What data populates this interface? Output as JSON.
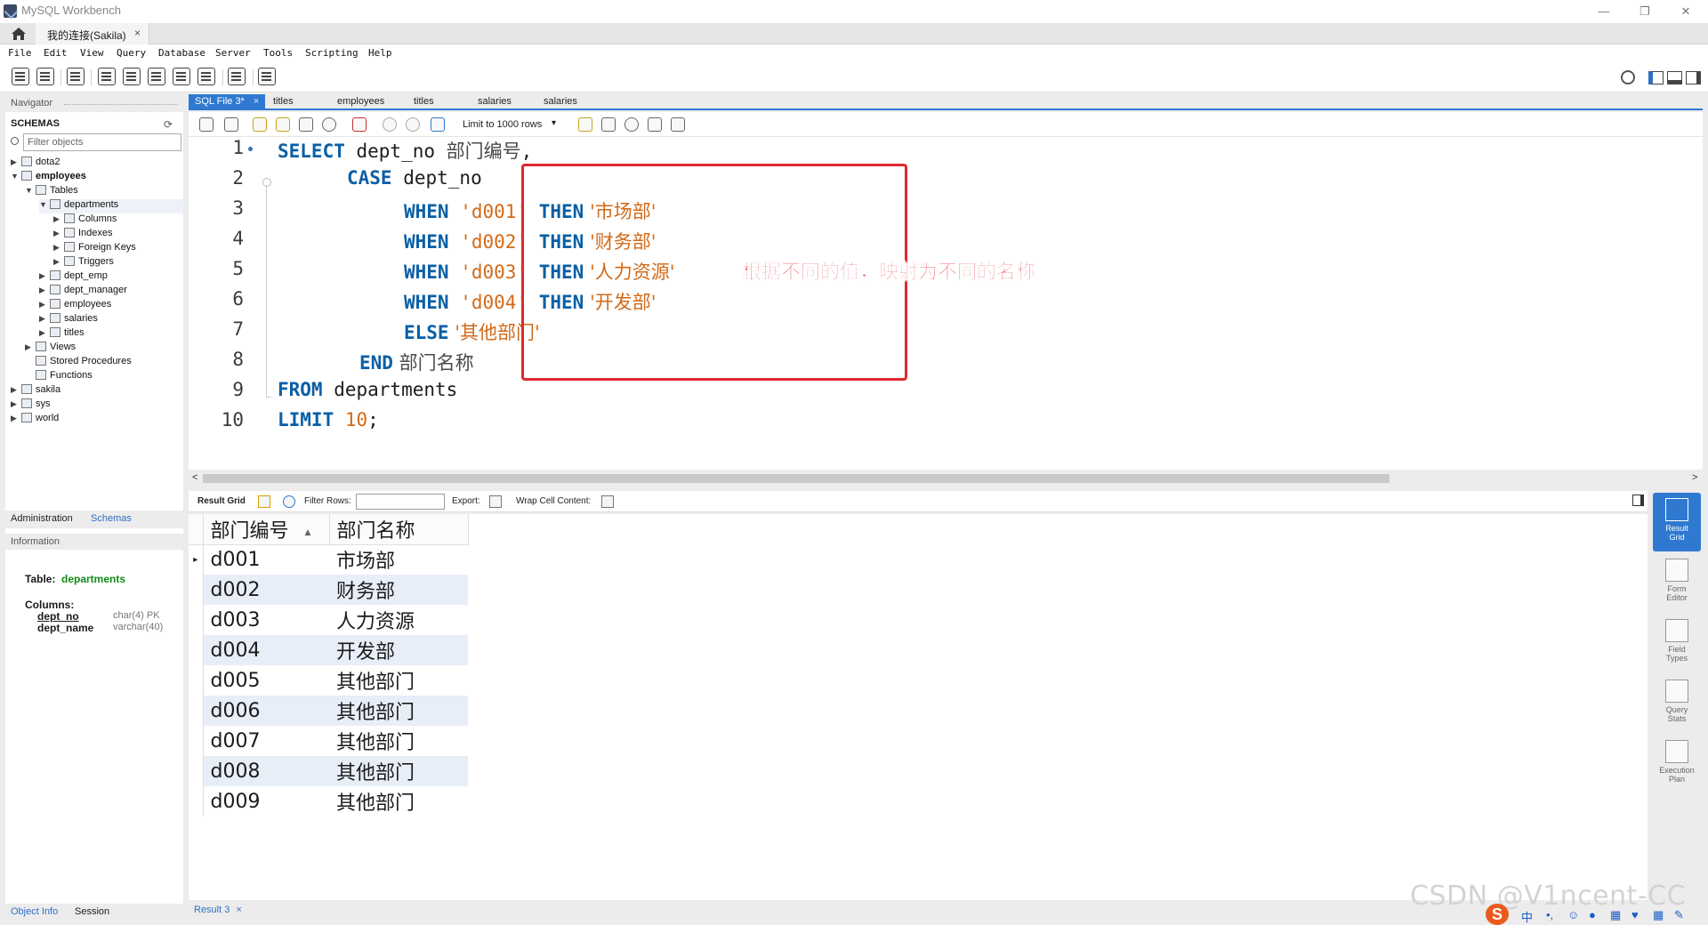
{
  "window": {
    "title": "MySQL Workbench",
    "min": "—",
    "max": "❐",
    "close": "✕"
  },
  "connection_tab": {
    "label": "我的连接(Sakila)",
    "close": "×"
  },
  "menu": [
    "File",
    "Edit",
    "View",
    "Query",
    "Database",
    "Server",
    "Tools",
    "Scripting",
    "Help"
  ],
  "navigator": {
    "header": "Navigator",
    "schemas_label": "SCHEMAS",
    "filter_placeholder": "Filter objects",
    "tree": [
      {
        "label": "dota2",
        "level": 0,
        "toggle": "▶"
      },
      {
        "label": "employees",
        "level": 0,
        "toggle": "▼",
        "bold": true
      },
      {
        "label": "Tables",
        "level": 1,
        "toggle": "▼"
      },
      {
        "label": "departments",
        "level": 2,
        "toggle": "▼",
        "selected": true
      },
      {
        "label": "Columns",
        "level": 3,
        "toggle": "▶"
      },
      {
        "label": "Indexes",
        "level": 3,
        "toggle": "▶"
      },
      {
        "label": "Foreign Keys",
        "level": 3,
        "toggle": "▶"
      },
      {
        "label": "Triggers",
        "level": 3,
        "toggle": "▶"
      },
      {
        "label": "dept_emp",
        "level": 2,
        "toggle": "▶"
      },
      {
        "label": "dept_manager",
        "level": 2,
        "toggle": "▶"
      },
      {
        "label": "employees",
        "level": 2,
        "toggle": "▶"
      },
      {
        "label": "salaries",
        "level": 2,
        "toggle": "▶"
      },
      {
        "label": "titles",
        "level": 2,
        "toggle": "▶"
      },
      {
        "label": "Views",
        "level": 1,
        "toggle": "▶"
      },
      {
        "label": "Stored Procedures",
        "level": 1,
        "toggle": ""
      },
      {
        "label": "Functions",
        "level": 1,
        "toggle": ""
      },
      {
        "label": "sakila",
        "level": 0,
        "toggle": "▶"
      },
      {
        "label": "sys",
        "level": 0,
        "toggle": "▶"
      },
      {
        "label": "world",
        "level": 0,
        "toggle": "▶"
      }
    ],
    "tabs": [
      "Administration",
      "Schemas"
    ],
    "info_header": "Information",
    "info": {
      "table_label": "Table:",
      "table_name": "departments",
      "columns_label": "Columns:",
      "columns": [
        {
          "name": "dept_no",
          "type": "char(4) PK"
        },
        {
          "name": "dept_name",
          "type": "varchar(40)"
        }
      ]
    },
    "bottom_tabs": [
      "Object Info",
      "Session"
    ]
  },
  "editor_tabs": [
    {
      "label": "SQL File 3*",
      "active": true,
      "close": "×"
    },
    {
      "label": "titles"
    },
    {
      "label": "employees"
    },
    {
      "label": "titles"
    },
    {
      "label": "salaries"
    },
    {
      "label": "salaries"
    }
  ],
  "editor_toolbar": {
    "limit": "Limit to 1000 rows"
  },
  "code": {
    "line_numbers": [
      "1",
      "2",
      "3",
      "4",
      "5",
      "6",
      "7",
      "8",
      "9",
      "10"
    ],
    "l1": {
      "kw": "SELECT",
      "ident": " dept_no ",
      "alias": "部门编号",
      "tail": ","
    },
    "l2": {
      "kw": "CASE",
      "ident": " dept_no"
    },
    "l3": {
      "kw1": "WHEN",
      "s1": " 'd001' ",
      "kw2": "THEN",
      "s2": " '市场部'"
    },
    "l4": {
      "kw1": "WHEN",
      "s1": " 'd002' ",
      "kw2": "THEN",
      "s2": " '财务部'"
    },
    "l5": {
      "kw1": "WHEN",
      "s1": " 'd003' ",
      "kw2": "THEN",
      "s2": " '人力资源'"
    },
    "l6": {
      "kw1": "WHEN",
      "s1": " 'd004' ",
      "kw2": "THEN",
      "s2": " '开发部'"
    },
    "l7": {
      "kw": "ELSE",
      "s": " '其他部门'"
    },
    "l8": {
      "kw": "END",
      "alias": " 部门名称"
    },
    "l9": {
      "kw": "FROM",
      "ident": " departments"
    },
    "l10": {
      "kw": "LIMIT",
      "num": " 10",
      "tail": ";"
    }
  },
  "annotation": "根据不同的值，映射为不同的名称",
  "result_toolbar": {
    "result_grid": "Result Grid",
    "filter_rows": "Filter Rows:",
    "export": "Export:",
    "wrap": "Wrap Cell Content:"
  },
  "result_grid": {
    "columns": [
      "部门编号",
      "部门名称"
    ],
    "rows": [
      [
        "d001",
        "市场部"
      ],
      [
        "d002",
        "财务部"
      ],
      [
        "d003",
        "人力资源"
      ],
      [
        "d004",
        "开发部"
      ],
      [
        "d005",
        "其他部门"
      ],
      [
        "d006",
        "其他部门"
      ],
      [
        "d007",
        "其他部门"
      ],
      [
        "d008",
        "其他部门"
      ],
      [
        "d009",
        "其他部门"
      ]
    ]
  },
  "right_panel": [
    {
      "line1": "Result",
      "line2": "Grid",
      "active": true
    },
    {
      "line1": "Form",
      "line2": "Editor"
    },
    {
      "line1": "Field",
      "line2": "Types"
    },
    {
      "line1": "Query",
      "line2": "Stats"
    },
    {
      "line1": "Execution",
      "line2": "Plan"
    }
  ],
  "bottom_tab": {
    "label": "Result 3",
    "close": "×"
  },
  "watermark": "CSDN @V1ncent-CC",
  "tray": {
    "logo": "S",
    "ime": "中"
  },
  "colors": {
    "accent": "#2f7ad0",
    "keyword": "#0a5fa5",
    "string": "#d26a18",
    "annotation": "#e8283a",
    "highlight_box": "#e0282f"
  }
}
